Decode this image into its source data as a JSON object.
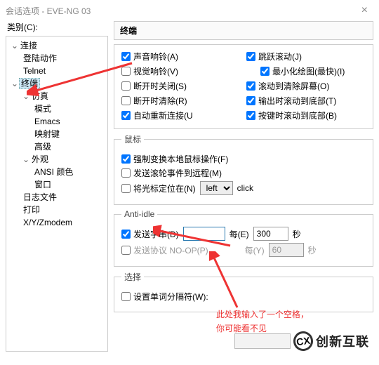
{
  "titlebar": {
    "title": "会话选项 - EVE-NG 03",
    "close": "×"
  },
  "sidebar": {
    "label": "类别(C):",
    "nodes": {
      "connect": "连接",
      "loginAction": "登陆动作",
      "telnet": "Telnet",
      "terminal": "终端",
      "emu": "仿真",
      "mode": "模式",
      "emacs": "Emacs",
      "mapkeys": "映射键",
      "advanced": "高级",
      "appearance": "外观",
      "ansi": "ANSI 颜色",
      "window": "窗口",
      "logfile": "日志文件",
      "print": "打印",
      "xyz": "X/Y/Zmodem"
    }
  },
  "panel": {
    "heading": "终端",
    "terminal": {
      "audioBell": "声音响铃(A)",
      "visualBell": "视觉响铃(V)",
      "closeOnDisc": "断开时关闭(S)",
      "clearOnDisc": "断开时清除(R)",
      "autoReconnect": "自动重新连接(U",
      "jumpScroll": "跳跃滚动(J)",
      "minDraw": "最小化绘图(最快)(I)",
      "scrollClearScreen": "滚动到清除屏幕(O)",
      "outputScrollBottom": "输出时滚动到底部(T)",
      "keyScrollBottom": "按键时滚动到底部(B)"
    },
    "mouse": {
      "legend": "鼠标",
      "forceLocal": "强制变换本地鼠标操作(F)",
      "sendWheel": "发送滚轮事件到远程(M)",
      "placeCursor": "将光标定位在(N)",
      "side": "left",
      "action": "click"
    },
    "anti": {
      "legend": "Anti-idle",
      "sendString": "发送字串(D)",
      "every": "每(E)",
      "seconds": "秒",
      "intervalD": "300",
      "sendNoop": "发送协议 NO-OP(P)",
      "everyY": "每(Y)",
      "intervalP": "60"
    },
    "select": {
      "legend": "选择",
      "wordDelim": "设置单词分隔符(W):"
    }
  },
  "annotation": {
    "line1": "此处我输入了一个空格，",
    "line2": "你可能看不见"
  },
  "footer": {
    "brand": "创新互联"
  }
}
